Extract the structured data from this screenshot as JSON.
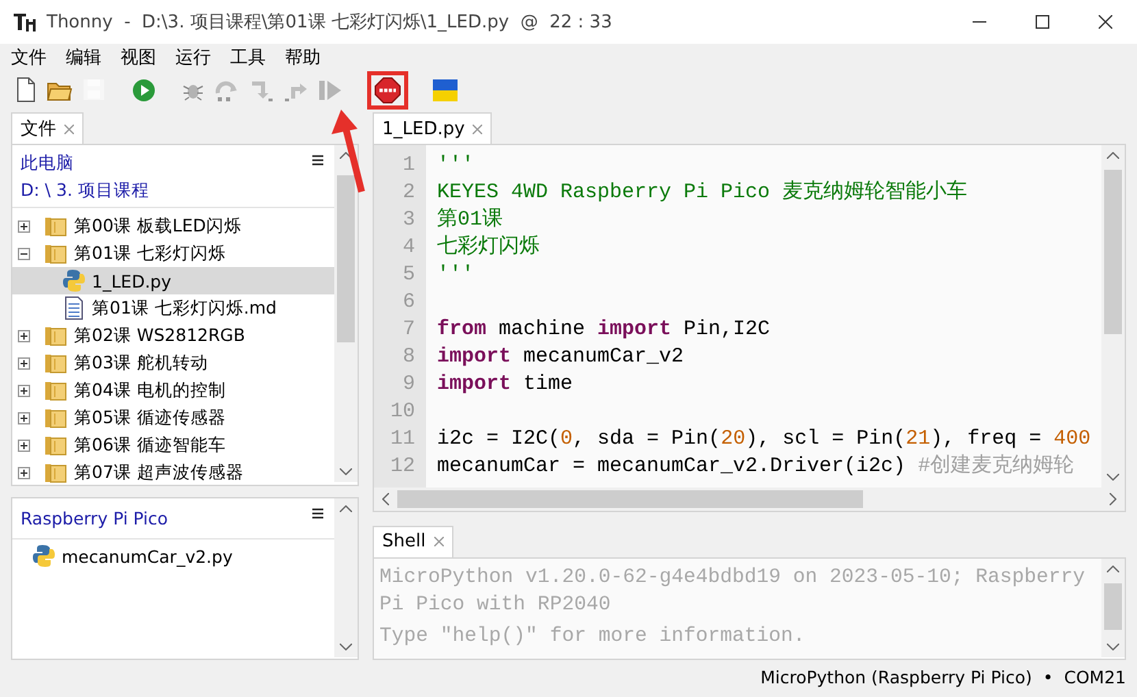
{
  "window": {
    "title": "Thonny  -  D:\\3. 项目课程\\第01课 七彩灯闪烁\\1_LED.py  @  22 : 33"
  },
  "menu": [
    "文件",
    "编辑",
    "视图",
    "运行",
    "工具",
    "帮助"
  ],
  "toolbar": [
    {
      "kind": "new",
      "disabled": false,
      "highlighted": false
    },
    {
      "kind": "open",
      "disabled": false,
      "highlighted": false
    },
    {
      "kind": "save",
      "disabled": true,
      "highlighted": false
    },
    {
      "kind": "run",
      "disabled": false,
      "highlighted": false
    },
    {
      "kind": "debug",
      "disabled": true,
      "highlighted": false
    },
    {
      "kind": "step-over",
      "disabled": true,
      "highlighted": false
    },
    {
      "kind": "step-into",
      "disabled": true,
      "highlighted": false
    },
    {
      "kind": "step-out",
      "disabled": true,
      "highlighted": false
    },
    {
      "kind": "resume",
      "disabled": true,
      "highlighted": false
    },
    {
      "kind": "stop",
      "disabled": false,
      "highlighted": true
    },
    {
      "kind": "flag",
      "disabled": false,
      "highlighted": false
    }
  ],
  "files_panel": {
    "tab": {
      "label": "文件",
      "selected": true
    },
    "location": [
      "此电脑",
      "D: \\ 3. 项目课程"
    ],
    "tree": [
      {
        "label": "第00课 板载LED闪烁",
        "kind": "folder",
        "expanded": false,
        "selected": false
      },
      {
        "label": "第01课 七彩灯闪烁",
        "kind": "folder",
        "expanded": true,
        "selected": false,
        "children": [
          {
            "label": "1_LED.py",
            "kind": "python",
            "selected": true
          },
          {
            "label": "第01课 七彩灯闪烁.md",
            "kind": "text",
            "selected": false
          }
        ]
      },
      {
        "label": "第02课 WS2812RGB",
        "kind": "folder",
        "expanded": false,
        "selected": false
      },
      {
        "label": "第03课 舵机转动",
        "kind": "folder",
        "expanded": false,
        "selected": false
      },
      {
        "label": "第04课 电机的控制",
        "kind": "folder",
        "expanded": false,
        "selected": false
      },
      {
        "label": "第05课 循迹传感器",
        "kind": "folder",
        "expanded": false,
        "selected": false
      },
      {
        "label": "第06课 循迹智能车",
        "kind": "folder",
        "expanded": false,
        "selected": false
      },
      {
        "label": "第07课 超声波传感器",
        "kind": "folder",
        "expanded": false,
        "selected": false
      }
    ]
  },
  "device_panel": {
    "title": "Raspberry Pi Pico",
    "files": [
      {
        "label": "mecanumCar_v2.py",
        "kind": "python",
        "selected": false
      }
    ]
  },
  "editor": {
    "tabs": [
      {
        "label": "1_LED.py",
        "selected": true
      }
    ],
    "lines": [
      {
        "number": "1",
        "tokens": [
          {
            "text": "'''",
            "kind": "string"
          }
        ]
      },
      {
        "number": "2",
        "tokens": [
          {
            "text": "KEYES 4WD Raspberry Pi Pico 麦克纳姆轮智能小车",
            "kind": "string"
          }
        ]
      },
      {
        "number": "3",
        "tokens": [
          {
            "text": "第01课",
            "kind": "string"
          }
        ]
      },
      {
        "number": "4",
        "tokens": [
          {
            "text": "七彩灯闪烁",
            "kind": "string"
          }
        ]
      },
      {
        "number": "5",
        "tokens": [
          {
            "text": "'''",
            "kind": "string"
          }
        ]
      },
      {
        "number": "6"
      },
      {
        "number": "7",
        "tokens": [
          {
            "text": "from",
            "kind": "keyword"
          },
          {
            "text": " machine ",
            "kind": "plain"
          },
          {
            "text": "import",
            "kind": "keyword"
          },
          {
            "text": " Pin,I2C",
            "kind": "plain"
          }
        ]
      },
      {
        "number": "8",
        "tokens": [
          {
            "text": "import",
            "kind": "keyword"
          },
          {
            "text": " mecanumCar_v2",
            "kind": "plain"
          }
        ]
      },
      {
        "number": "9",
        "tokens": [
          {
            "text": "import",
            "kind": "keyword"
          },
          {
            "text": " time",
            "kind": "plain"
          }
        ]
      },
      {
        "number": "10"
      },
      {
        "number": "11",
        "tokens": [
          {
            "text": "i2c = I2C(",
            "kind": "plain"
          },
          {
            "text": "0",
            "kind": "number"
          },
          {
            "text": ", sda = Pin(",
            "kind": "plain"
          },
          {
            "text": "20",
            "kind": "number"
          },
          {
            "text": "), scl = Pin(",
            "kind": "plain"
          },
          {
            "text": "21",
            "kind": "number"
          },
          {
            "text": "), freq = ",
            "kind": "plain"
          },
          {
            "text": "400",
            "kind": "number"
          }
        ]
      },
      {
        "number": "12",
        "tokens": [
          {
            "text": "mecanumCar = mecanumCar_v2.Driver(i2c) ",
            "kind": "plain"
          },
          {
            "text": "#创建麦克纳姆轮",
            "kind": "comment"
          }
        ]
      }
    ]
  },
  "shell": {
    "tab": {
      "label": "Shell",
      "selected": true
    },
    "output": [
      "MicroPython v1.20.0-62-g4e4bdbd19 on 2023-05-10; Raspberry Pi Pico with RP2040",
      "Type \"help()\" for more information."
    ]
  },
  "status_bar": {
    "interpreter": "MicroPython (Raspberry Pi Pico)",
    "separator": "•",
    "port": "COM21"
  }
}
